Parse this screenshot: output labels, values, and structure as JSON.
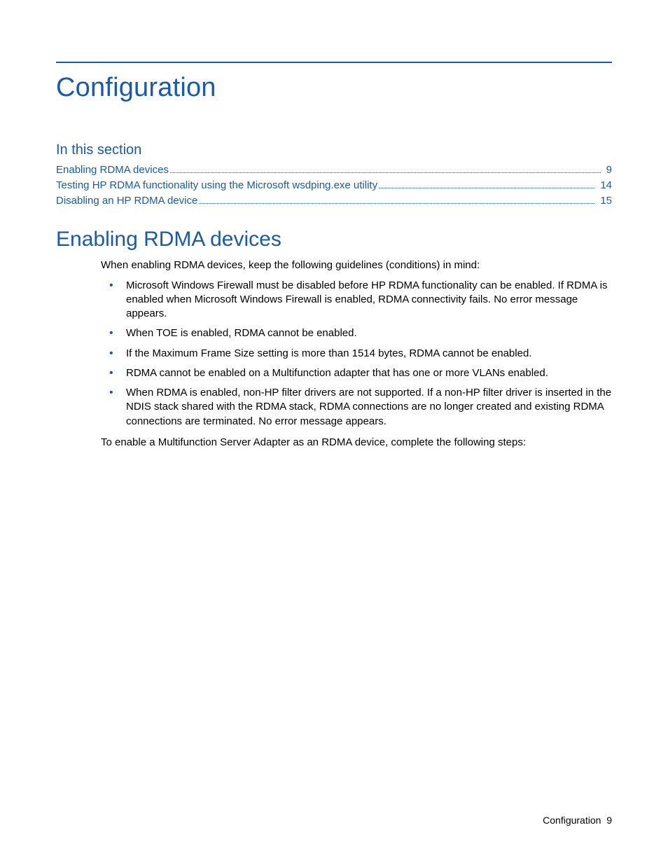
{
  "title": "Configuration",
  "section_label": "In this section",
  "toc": [
    {
      "label": "Enabling RDMA devices",
      "page": "9"
    },
    {
      "label": "Testing HP RDMA functionality using the Microsoft wsdping.exe utility",
      "page": "14"
    },
    {
      "label": "Disabling an HP RDMA device",
      "page": "15"
    }
  ],
  "subtitle": "Enabling RDMA devices",
  "intro": "When enabling RDMA devices, keep the following guidelines (conditions) in mind:",
  "bullets": [
    "Microsoft Windows Firewall must be disabled before HP RDMA functionality can be enabled. If RDMA is enabled when Microsoft Windows Firewall is enabled, RDMA connectivity fails. No error message appears.",
    "When TOE is enabled, RDMA cannot be enabled.",
    "If the Maximum Frame Size setting is more than 1514 bytes, RDMA cannot be enabled.",
    "RDMA cannot be enabled on a Multifunction adapter that has one or more VLANs enabled.",
    "When RDMA is enabled, non-HP filter drivers are not supported. If a non-HP filter driver is inserted in the NDIS stack shared with the RDMA stack, RDMA connections are no longer created and existing RDMA connections are terminated. No error message appears."
  ],
  "outro": "To enable a Multifunction Server Adapter as an RDMA device, complete the following steps:",
  "footer": {
    "label": "Configuration",
    "page": "9"
  }
}
